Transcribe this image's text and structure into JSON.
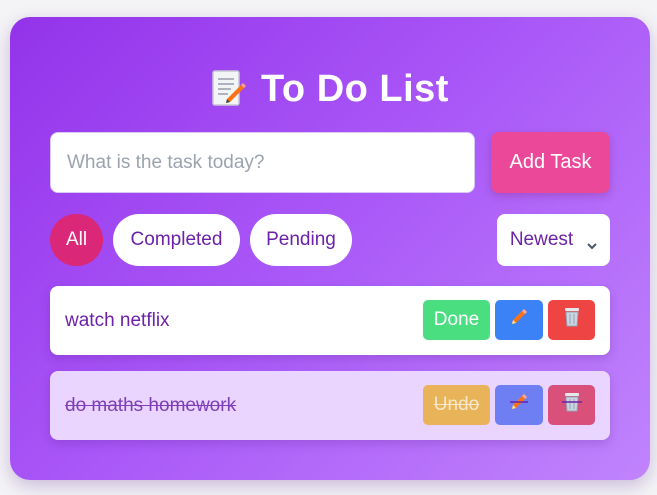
{
  "header": {
    "title": "To Do List",
    "icon": "memo-icon"
  },
  "new_task": {
    "placeholder": "What is the task today?",
    "value": "",
    "add_label": "Add Task"
  },
  "filters": [
    {
      "label": "All",
      "active": true
    },
    {
      "label": "Completed",
      "active": false
    },
    {
      "label": "Pending",
      "active": false
    }
  ],
  "sort": {
    "selected": "Newest"
  },
  "tasks": [
    {
      "text": "watch netflix",
      "completed": false,
      "toggle_label": "Done",
      "edit_icon": "pencil-icon",
      "delete_icon": "trash-icon"
    },
    {
      "text": "do maths homework",
      "completed": true,
      "toggle_label": "Undo",
      "edit_icon": "pencil-icon",
      "delete_icon": "trash-icon"
    }
  ],
  "colors": {
    "accent": "#ec4899",
    "active_filter": "#db2777",
    "done": "#4ade80",
    "edit": "#3b82f6",
    "delete": "#ef4444",
    "text": "#6b21a8"
  }
}
